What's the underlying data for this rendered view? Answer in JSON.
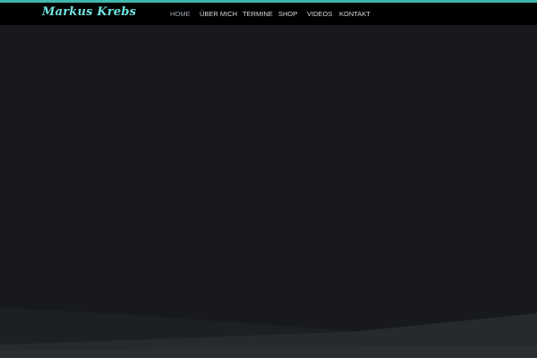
{
  "header": {
    "logo_text": "Markus Krebs"
  },
  "nav": {
    "items": [
      {
        "label": "HOME",
        "active": true
      },
      {
        "label": "ÜBER MICH",
        "active": false
      },
      {
        "label": "TERMINE",
        "active": false
      },
      {
        "label": "SHOP",
        "active": false
      },
      {
        "label": "VIDEOS",
        "active": false
      },
      {
        "label": "KONTAKT",
        "active": false
      }
    ]
  },
  "colors": {
    "accent": "#3fb7ad",
    "logo": "#6fe3e0",
    "header_bg": "#000000",
    "page_bg": "#16181b"
  }
}
